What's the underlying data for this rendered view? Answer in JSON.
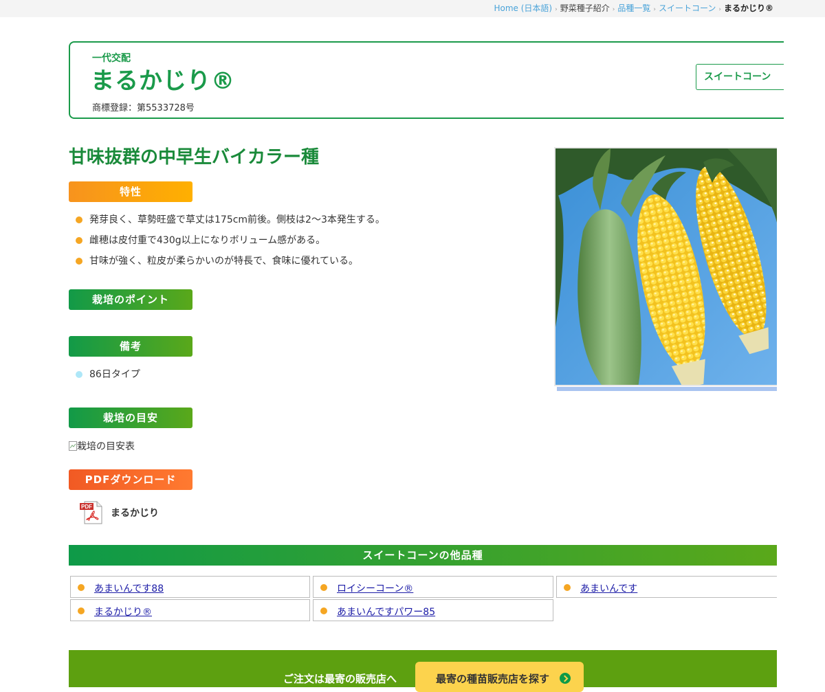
{
  "breadcrumb": {
    "home": "Home (日本語)",
    "section": "野菜種子紹介",
    "list": "品種一覧",
    "category": "スイートコーン",
    "current": "まるかじり®"
  },
  "header": {
    "subtitle": "一代交配",
    "title": "まるかじり®",
    "trademark": "商標登録：第5533728号",
    "category_button": "スイートコーン"
  },
  "tagline": "甘味抜群の中早生バイカラー種",
  "sections": {
    "features_label": "特性",
    "features": [
      "発芽良く、草勢旺盛で草丈は175cm前後。側枝は2〜3本発生する。",
      "雌穂は皮付重で430g以上になりボリューム感がある。",
      "甘味が強く、粒皮が柔らかいのが特長で、食味に優れている。"
    ],
    "cultivation_points_label": "栽培のポイント",
    "notes_label": "備考",
    "notes": [
      "86日タイプ"
    ],
    "guide_label": "栽培の目安",
    "guide_image_alt": "栽培の目安表",
    "pdf_label": "PDFダウンロード",
    "pdf_icon_text": "PDF",
    "pdf_file": "まるかじり"
  },
  "others": {
    "title": "スイートコーンの他品種",
    "items": [
      "あまいんです88",
      "ロイシーコーン®",
      "あまいんです",
      "まるかじり®",
      "あまいんですパワー85"
    ]
  },
  "footer": {
    "text": "ご注文は最寄の販売店へ",
    "button": "最寄の種苗販売店を探す"
  },
  "colors": {
    "brand_green": "#1a9a4a",
    "orange_label": "#f7931e",
    "link_blue": "#1a1aa6",
    "footer_green": "#5da010",
    "button_yellow": "#fcd34d"
  }
}
